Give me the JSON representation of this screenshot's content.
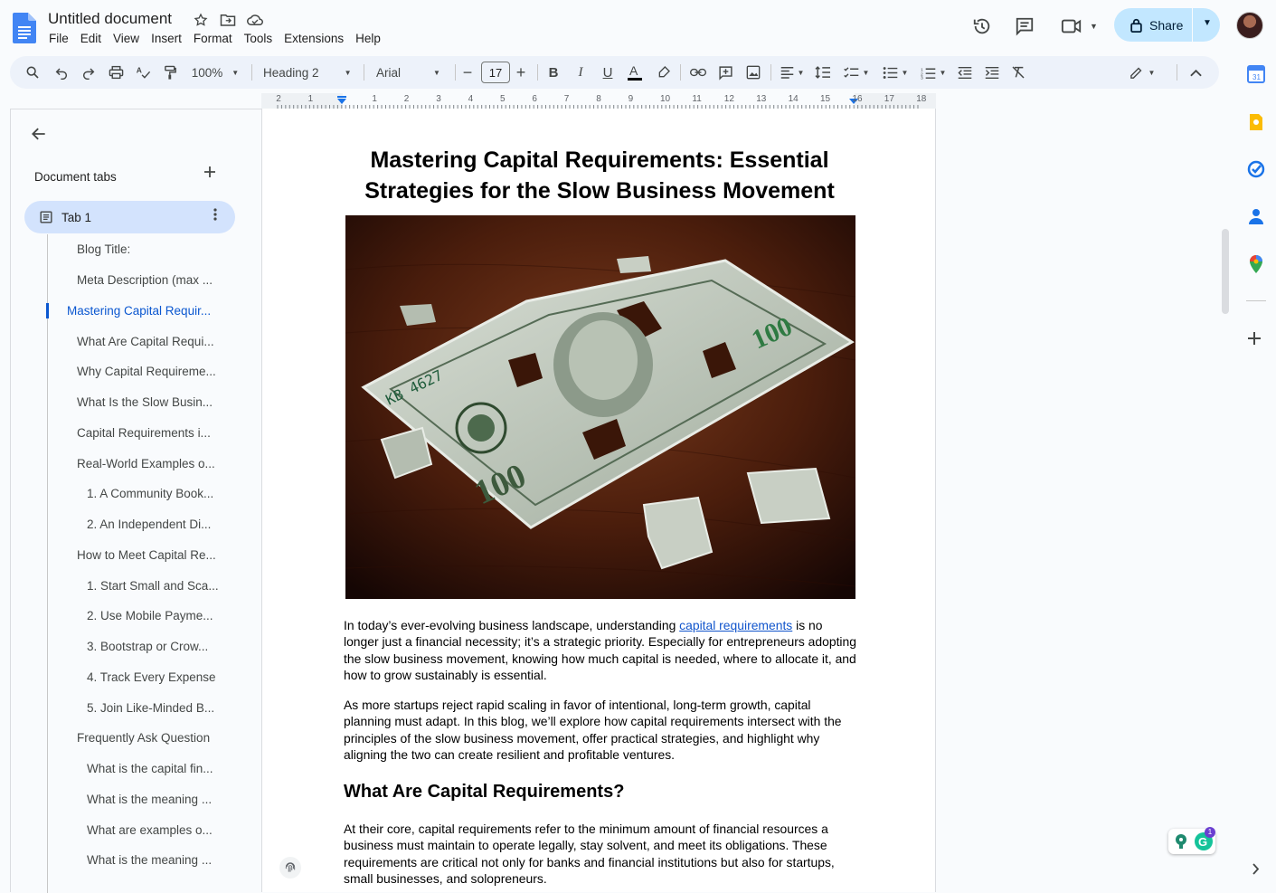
{
  "app": {
    "doc_title": "Untitled document",
    "menu": [
      "File",
      "Edit",
      "View",
      "Insert",
      "Format",
      "Tools",
      "Extensions",
      "Help"
    ],
    "share_label": "Share"
  },
  "toolbar": {
    "zoom": "100%",
    "style": "Heading 2",
    "font": "Arial",
    "font_size": "17"
  },
  "ruler": {
    "numbers": [
      "2",
      "1",
      "1",
      "2",
      "3",
      "4",
      "5",
      "6",
      "7",
      "8",
      "9",
      "10",
      "11",
      "12",
      "13",
      "14",
      "15",
      "16",
      "17",
      "18"
    ]
  },
  "sidepanel": {
    "heading": "Document tabs",
    "tab_label": "Tab 1",
    "outline": [
      {
        "text": "Blog Title:",
        "level": 1
      },
      {
        "text": "Meta Description (max ...",
        "level": 1
      },
      {
        "text": "Mastering Capital Requir...",
        "level": 0,
        "active": true
      },
      {
        "text": "What Are Capital Requi...",
        "level": 1
      },
      {
        "text": "Why Capital Requireme...",
        "level": 1
      },
      {
        "text": "What Is the Slow Busin...",
        "level": 1
      },
      {
        "text": "Capital Requirements i...",
        "level": 1
      },
      {
        "text": "Real-World Examples o...",
        "level": 1
      },
      {
        "text": "1. A Community Book...",
        "level": 2
      },
      {
        "text": "2. An Independent Di...",
        "level": 2
      },
      {
        "text": "How to Meet Capital Re...",
        "level": 1
      },
      {
        "text": "1. Start Small and Sca...",
        "level": 2
      },
      {
        "text": "2. Use Mobile Payme...",
        "level": 2
      },
      {
        "text": "3. Bootstrap or Crow...",
        "level": 2
      },
      {
        "text": "4. Track Every Expense",
        "level": 2
      },
      {
        "text": "5. Join Like-Minded B...",
        "level": 2
      },
      {
        "text": "Frequently Ask Question",
        "level": 1
      },
      {
        "text": "What is the capital fin...",
        "level": 2
      },
      {
        "text": "What is the meaning ...",
        "level": 2
      },
      {
        "text": "What are examples o...",
        "level": 2
      },
      {
        "text": "What is the meaning ...",
        "level": 2
      }
    ]
  },
  "document": {
    "title": "Mastering Capital Requirements: Essential Strategies for the Slow Business Movement",
    "p1_before": "In today’s ever-evolving business landscape, understanding ",
    "p1_link": "capital requirements",
    "p1_after": " is no longer just a financial necessity; it’s a strategic priority. Especially for entrepreneurs adopting the slow business movement, knowing how much capital is needed, where to allocate it, and how to grow sustainably is essential.",
    "p2": "As more startups reject rapid scaling in favor of intentional, long-term growth, capital planning must adapt. In this blog, we’ll explore how capital requirements intersect with the principles of the slow business movement, offer practical strategies, and highlight why aligning the two can create resilient and profitable ventures.",
    "h2": "What Are Capital Requirements?",
    "p3": "At their core, capital requirements refer to the minimum amount of financial resources a business must maintain to operate legally, stay solvent, and meet its obligations. These requirements are critical not only for banks and financial institutions but also for startups, small businesses, and solopreneurs."
  },
  "image": {
    "bill_serial": "KB 4627",
    "bill_denomination": "100"
  },
  "extensions": {
    "grammarly_badge": "1"
  },
  "colors": {
    "accent": "#0b57d0",
    "share_bg": "#c2e7ff",
    "tab_active": "#d3e3fd",
    "toolbar_bg": "#edf2fa"
  }
}
